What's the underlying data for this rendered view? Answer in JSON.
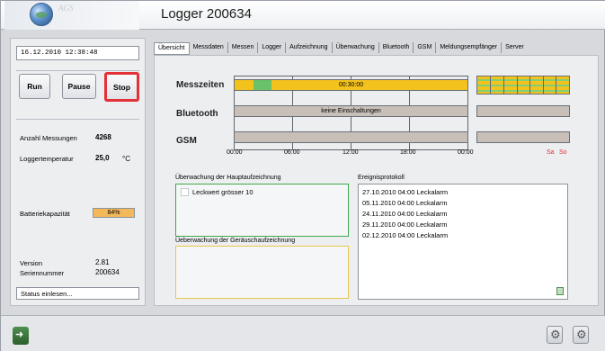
{
  "app": {
    "title": "Logger 200634",
    "logo_word": "AGS"
  },
  "left_panel": {
    "datetime": "16.12.2010 12:38:48",
    "buttons": {
      "run": "Run",
      "pause": "Pause",
      "stop": "Stop"
    },
    "measurements_label": "Anzahl Messungen",
    "measurements_value": "4268",
    "temperature_label": "Loggertemperatur",
    "temperature_value": "25,0",
    "temperature_unit": "°C",
    "battery_label": "Batteriekapazität",
    "battery_value": "84%",
    "battery_level": 0.84,
    "version_label": "Version",
    "version_value": "2.81",
    "serial_label": "Seriennummer",
    "serial_value": "200634",
    "status_button": "Status einlesen..."
  },
  "tabs": [
    "Übersicht",
    "Messdaten",
    "Messen",
    "Logger",
    "Aufzeichnung",
    "Überwachung",
    "Bluetooth",
    "GSM",
    "Meldungsempfänger",
    "Server"
  ],
  "overview": {
    "rows": {
      "messzeiten": "Messzeiten",
      "bluetooth": "Bluetooth",
      "gsm": "GSM"
    },
    "messzeiten_bar_text": "00:30:00",
    "bluetooth_bar_text": "keine Einschaltungen",
    "time_ticks": [
      "00:00",
      "06:00",
      "12:00",
      "18:00",
      "00:00"
    ],
    "weekdays": {
      "sa": "Sa",
      "so": "So"
    },
    "colors": {
      "active": "#f4c21c",
      "inactive": "#c8bfb8",
      "measurement": "#69c267",
      "weekend": "#e23137"
    },
    "main_monitoring_title": "Überwachung der Hauptaufzeichnung",
    "main_monitoring_check_label": "Leckwert grösser 10",
    "noise_monitoring_title": "Üeberwachung der Geräuschaufzeichnung",
    "event_log_title": "Ereignisprotokoll",
    "events": [
      "27.10.2010 04:00 Leckalarm",
      "05.11.2010 04:00 Leckalarm",
      "24.11.2010 04:00 Leckalarm",
      "29.11.2010 04:00 Leckalarm",
      "02.12.2010 04:00 Leckalarm"
    ]
  },
  "icons": {
    "exit": "exit-icon",
    "settings_a": "gear-icon",
    "settings_b": "gear-icon",
    "trash": "trash-icon"
  }
}
